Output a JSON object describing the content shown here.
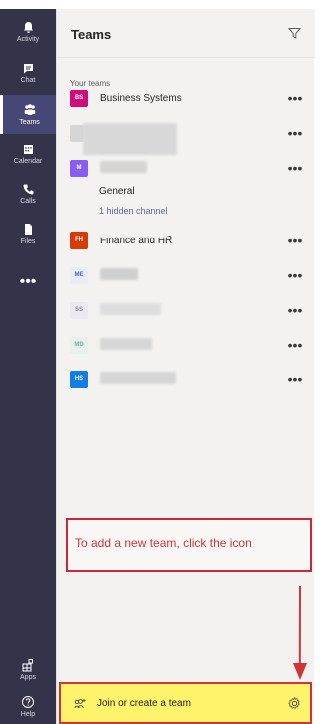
{
  "rail": {
    "items": [
      {
        "label": "Activity",
        "icon": "bell-icon"
      },
      {
        "label": "Chat",
        "icon": "chat-icon"
      },
      {
        "label": "Teams",
        "icon": "teams-icon",
        "active": true
      },
      {
        "label": "Calendar",
        "icon": "calendar-icon"
      },
      {
        "label": "Calls",
        "icon": "phone-icon"
      },
      {
        "label": "Files",
        "icon": "files-icon"
      }
    ],
    "more": "•••",
    "bottom_items": [
      {
        "label": "Apps",
        "icon": "apps-icon"
      },
      {
        "label": "Help",
        "icon": "help-icon"
      }
    ]
  },
  "header": {
    "title": "Teams",
    "filter_icon": "filter-icon"
  },
  "teams": {
    "section_label": "Your teams",
    "items": [
      {
        "initials": "BS",
        "name": "Business Systems",
        "color": "#d10b7c",
        "more": "•••"
      },
      {
        "initials": "",
        "name": "",
        "color": "#d6d6d6",
        "more": "•••"
      },
      {
        "initials": "M",
        "name": "",
        "color": "#8a5cf6",
        "more": "•••"
      },
      {
        "initials": "FH",
        "name": "Finance and HR",
        "color": "#d83b01",
        "more": "•••"
      },
      {
        "initials": "ME",
        "name": "",
        "color": "#e8ecf4",
        "more": "•••"
      },
      {
        "initials": "SS",
        "name": "",
        "color": "#ece8f2",
        "more": "•••"
      },
      {
        "initials": "MD",
        "name": "",
        "color": "#e4f1ed",
        "more": "•••"
      },
      {
        "initials": "HS",
        "name": "",
        "color": "#147ce5",
        "more": "•••"
      }
    ],
    "channels": {
      "general": "General",
      "hidden": "1 hidden channel"
    }
  },
  "callout": {
    "text": "To add a new team, click the icon"
  },
  "join": {
    "label": "Join or create a team",
    "icon": "join-team-icon",
    "settings_icon": "settings-icon"
  },
  "colors": {
    "rail": "#33344a",
    "accent": "#6264a7",
    "highlight": "#fff36b",
    "annotation_red": "#d13438"
  }
}
